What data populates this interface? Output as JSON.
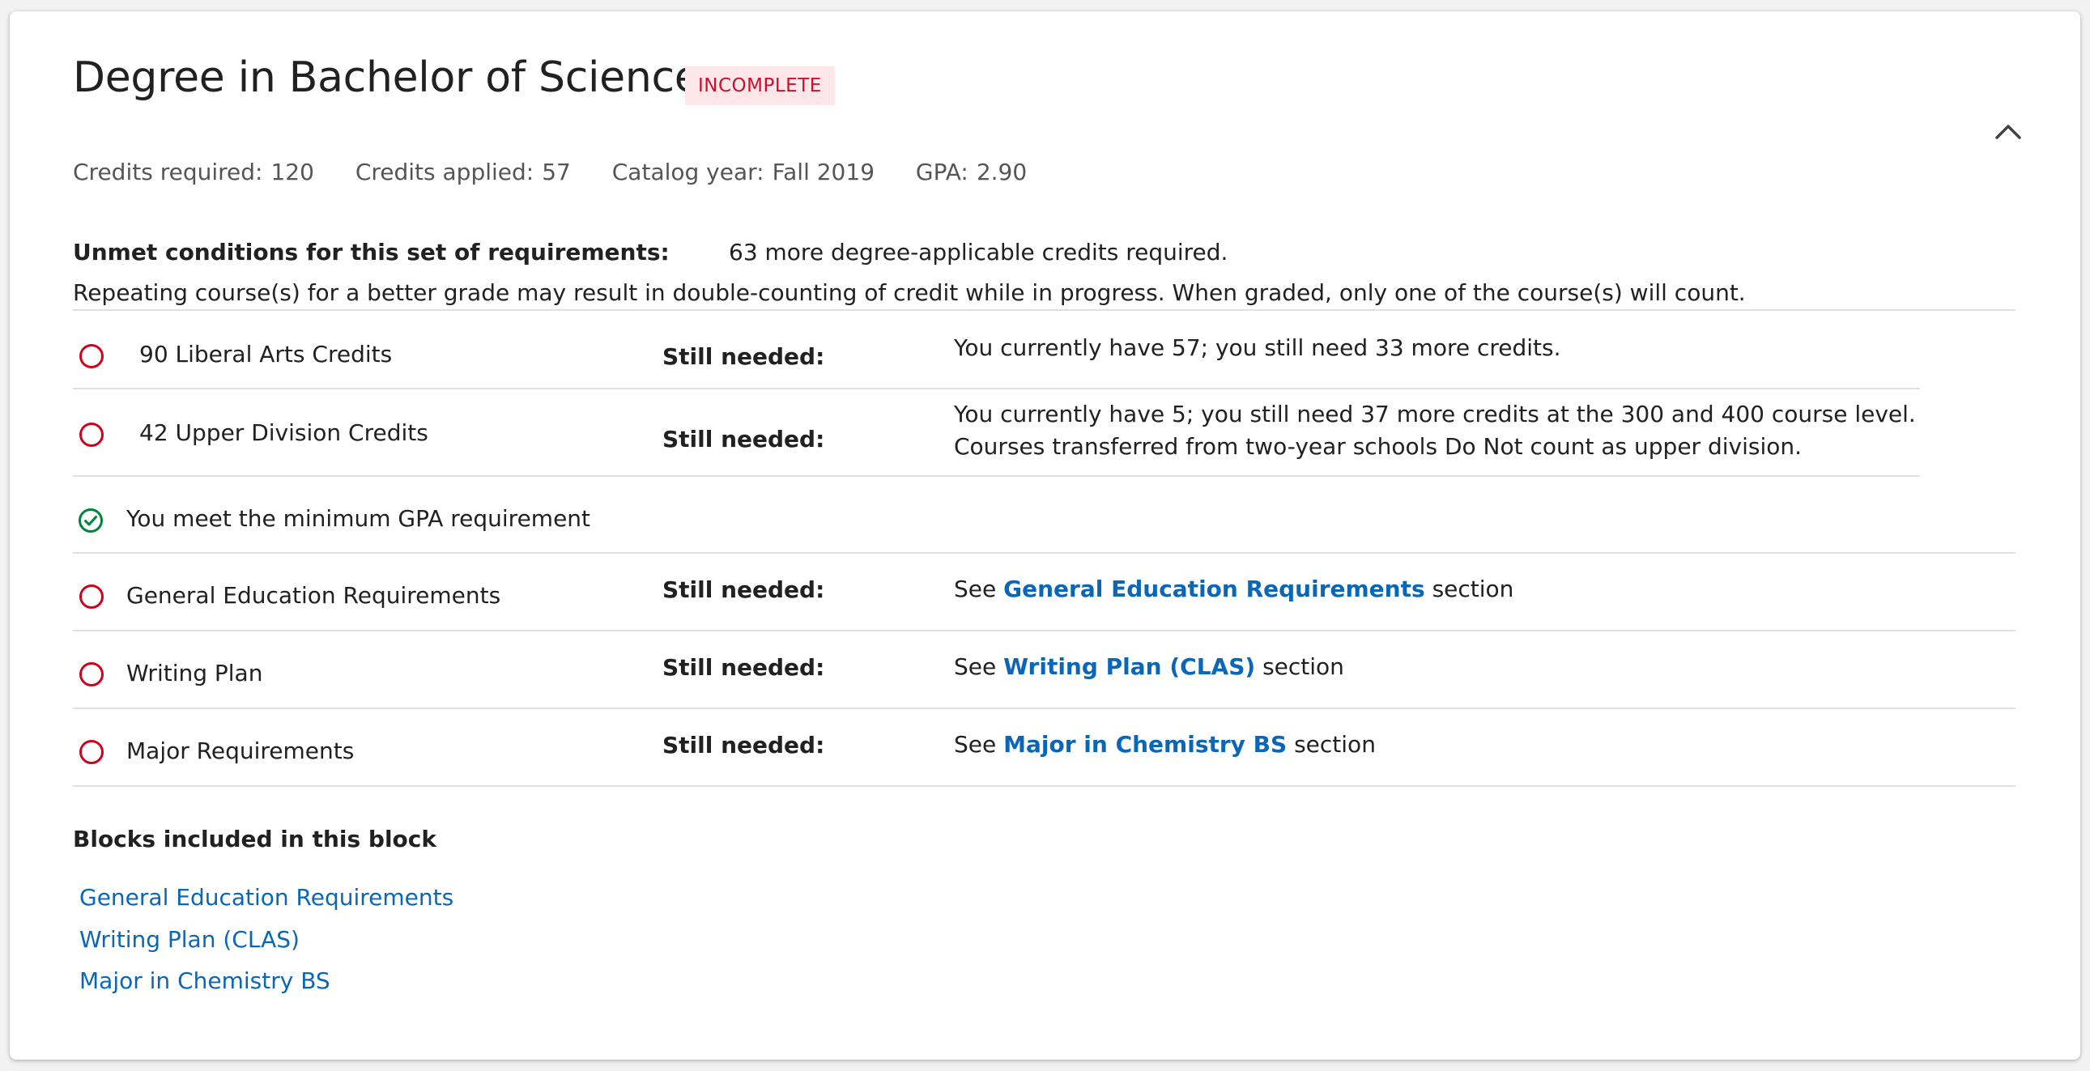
{
  "header": {
    "title": "Degree in Bachelor of Science",
    "status_badge": "INCOMPLETE",
    "collapse_icon": "chevron-up-icon"
  },
  "stats": {
    "credits_required_label": "Credits required:",
    "credits_required_value": "120",
    "credits_applied_label": "Credits applied:",
    "credits_applied_value": "57",
    "catalog_year_label": "Catalog year:",
    "catalog_year_value": "Fall 2019",
    "gpa_label": "GPA:",
    "gpa_value": "2.90"
  },
  "unmet": {
    "label": "Unmet conditions for this set of requirements:",
    "value": "63 more degree-applicable credits required.",
    "note": "Repeating course(s) for a better grade may result in double-counting of credit while in progress. When graded, only one of the course(s) will count."
  },
  "requirements": [
    {
      "label": "90 Liberal Arts Credits",
      "still_needed": "Still needed:",
      "detail_line1": "You currently have 57; you still need 33 more credits.",
      "status_icon": "unmet-circle-icon"
    },
    {
      "label": "42 Upper Division Credits",
      "still_needed": "Still needed:",
      "detail_line1": "You currently have 5; you still need 37 more credits at the 300 and 400 course level.",
      "detail_line2": "Courses transferred from two-year schools Do Not count as upper division.",
      "status_icon": "unmet-circle-icon"
    },
    {
      "label": "You meet the minimum GPA requirement",
      "status_icon": "check-circle-icon"
    },
    {
      "label": "General Education Requirements",
      "still_needed": "Still needed:",
      "see": "See",
      "link": "General Education Requirements",
      "suffix": "section",
      "status_icon": "unmet-circle-icon"
    },
    {
      "label": "Writing Plan",
      "still_needed": "Still needed:",
      "see": "See",
      "link": "Writing Plan (CLAS)",
      "suffix": "section",
      "status_icon": "unmet-circle-icon"
    },
    {
      "label": "Major Requirements",
      "still_needed": "Still needed:",
      "see": "See",
      "link": "Major in Chemistry BS",
      "suffix": "section",
      "status_icon": "unmet-circle-icon"
    }
  ],
  "blocks": {
    "heading": "Blocks included in this block",
    "links": [
      "General Education Requirements",
      "Writing Plan (CLAS)",
      "Major in Chemistry BS"
    ]
  },
  "colors": {
    "unmet_red": "#d0021b",
    "met_green": "#00843d",
    "link_blue": "#0a67b7",
    "badge_bg": "#fde7e8",
    "badge_text": "#c8102e"
  }
}
